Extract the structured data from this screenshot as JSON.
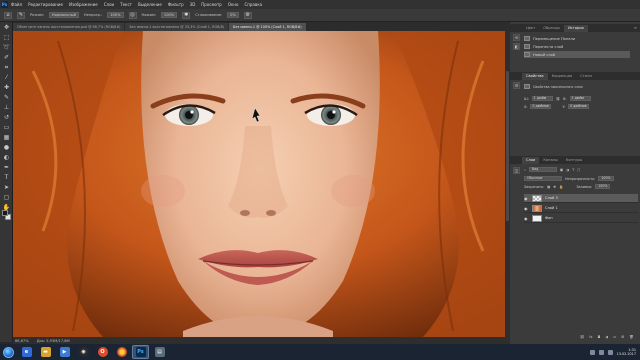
{
  "menubar": {
    "items": [
      "Файл",
      "Редактирование",
      "Изображение",
      "Слои",
      "Текст",
      "Выделение",
      "Фильтр",
      "3D",
      "Просмотр",
      "Окно",
      "Справка"
    ]
  },
  "optbar": {
    "mode_label": "Режим:",
    "mode_value": "Нормальный",
    "opacity_label": "Непрозр.:",
    "opacity_value": "100%",
    "flow_label": "Нажим:",
    "flow_value": "100%",
    "smooth_label": "Сглаживание:",
    "smooth_value": "0%"
  },
  "doc_tabs": [
    {
      "label": "Облегчите панель восстановления.psd @ 66,7% (RGB/8#)"
    },
    {
      "label": "Без имени-1 восстановлено @ 33,3% (Слой 1, RGB/8)"
    },
    {
      "label": "Без имени-1 @ 100% (Слой 1, RGB/8#)",
      "active": true
    }
  ],
  "status": {
    "zoom": "66,67%",
    "doc": "Док: 5,93M/17,8M"
  },
  "history_panel": {
    "tabs": [
      "Цвет",
      "Образцы",
      "История"
    ],
    "active_tab": "История",
    "items": [
      "Перемещение Панели",
      "Перенести слой",
      "Новый слой"
    ]
  },
  "properties_panel": {
    "tabs": [
      "Свойства",
      "Коррекция",
      "Стили"
    ],
    "title": "Свойства пиксельного слоя",
    "w_label": "Ш:",
    "w_value": "1 дюйм",
    "h_label": "В:",
    "h_value": "1 дюйм",
    "x_label": "X:",
    "x_value": "0 дюймов",
    "y_label": "Y:",
    "y_value": "0 дюймов"
  },
  "layers_panel": {
    "tabs": [
      "Слои",
      "Каналы",
      "Контуры"
    ],
    "filter_value": "Вид",
    "blend_value": "Обычные",
    "opacity_label": "Непрозрачность:",
    "opacity_value": "100%",
    "lock_label": "Закрепить:",
    "fill_label": "Заливка:",
    "fill_value": "100%",
    "layers": [
      {
        "name": "Слой 3",
        "active": true
      },
      {
        "name": "Слой 1"
      },
      {
        "name": "Фон"
      }
    ]
  },
  "taskbar": {
    "time": "1:31",
    "date": "13.02.2017"
  },
  "colors": {
    "hair": "#c4561a",
    "skin": "#e9b595",
    "accent": "#1d6fd0"
  }
}
